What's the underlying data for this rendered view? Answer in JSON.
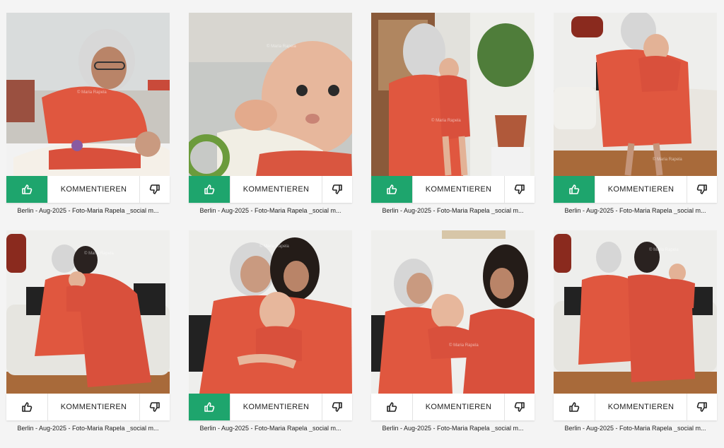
{
  "cards": [
    {
      "comment_label": "KOMMENTIEREN",
      "caption": "Berlin - Aug-2025 - Foto-Maria Rapela _social m...",
      "liked": true,
      "watermark": "© Maria Rapela"
    },
    {
      "comment_label": "KOMMENTIEREN",
      "caption": "Berlin - Aug-2025 - Foto-Maria Rapela _social m...",
      "liked": true,
      "watermark": "© Maria Rapela"
    },
    {
      "comment_label": "KOMMENTIEREN",
      "caption": "Berlin - Aug-2025 - Foto-Maria Rapela _social m...",
      "liked": true,
      "watermark": "© Maria Rapela"
    },
    {
      "comment_label": "KOMMENTIEREN",
      "caption": "Berlin - Aug-2025 - Foto-Maria Rapela _social m...",
      "liked": true,
      "watermark": "© Maria Rapela"
    },
    {
      "comment_label": "KOMMENTIEREN",
      "caption": "Berlin - Aug-2025 - Foto-Maria Rapela _social m...",
      "liked": false,
      "watermark": "© Maria Rapela"
    },
    {
      "comment_label": "KOMMENTIEREN",
      "caption": "Berlin - Aug-2025 - Foto-Maria Rapela _social m...",
      "liked": true,
      "watermark": "© Maria Rapela"
    },
    {
      "comment_label": "KOMMENTIEREN",
      "caption": "Berlin - Aug-2025 - Foto-Maria Rapela _social m...",
      "liked": false,
      "watermark": "© Maria Rapela"
    },
    {
      "comment_label": "KOMMENTIEREN",
      "caption": "Berlin - Aug-2025 - Foto-Maria Rapela _social m...",
      "liked": false,
      "watermark": "© Maria Rapela"
    }
  ],
  "icons": {
    "like": "thumbs-up-icon",
    "dislike": "thumbs-down-icon"
  },
  "colors": {
    "like_active": "#1ea56d",
    "dress_red": "#e0573f",
    "hair_gray": "#cfcfcf"
  }
}
